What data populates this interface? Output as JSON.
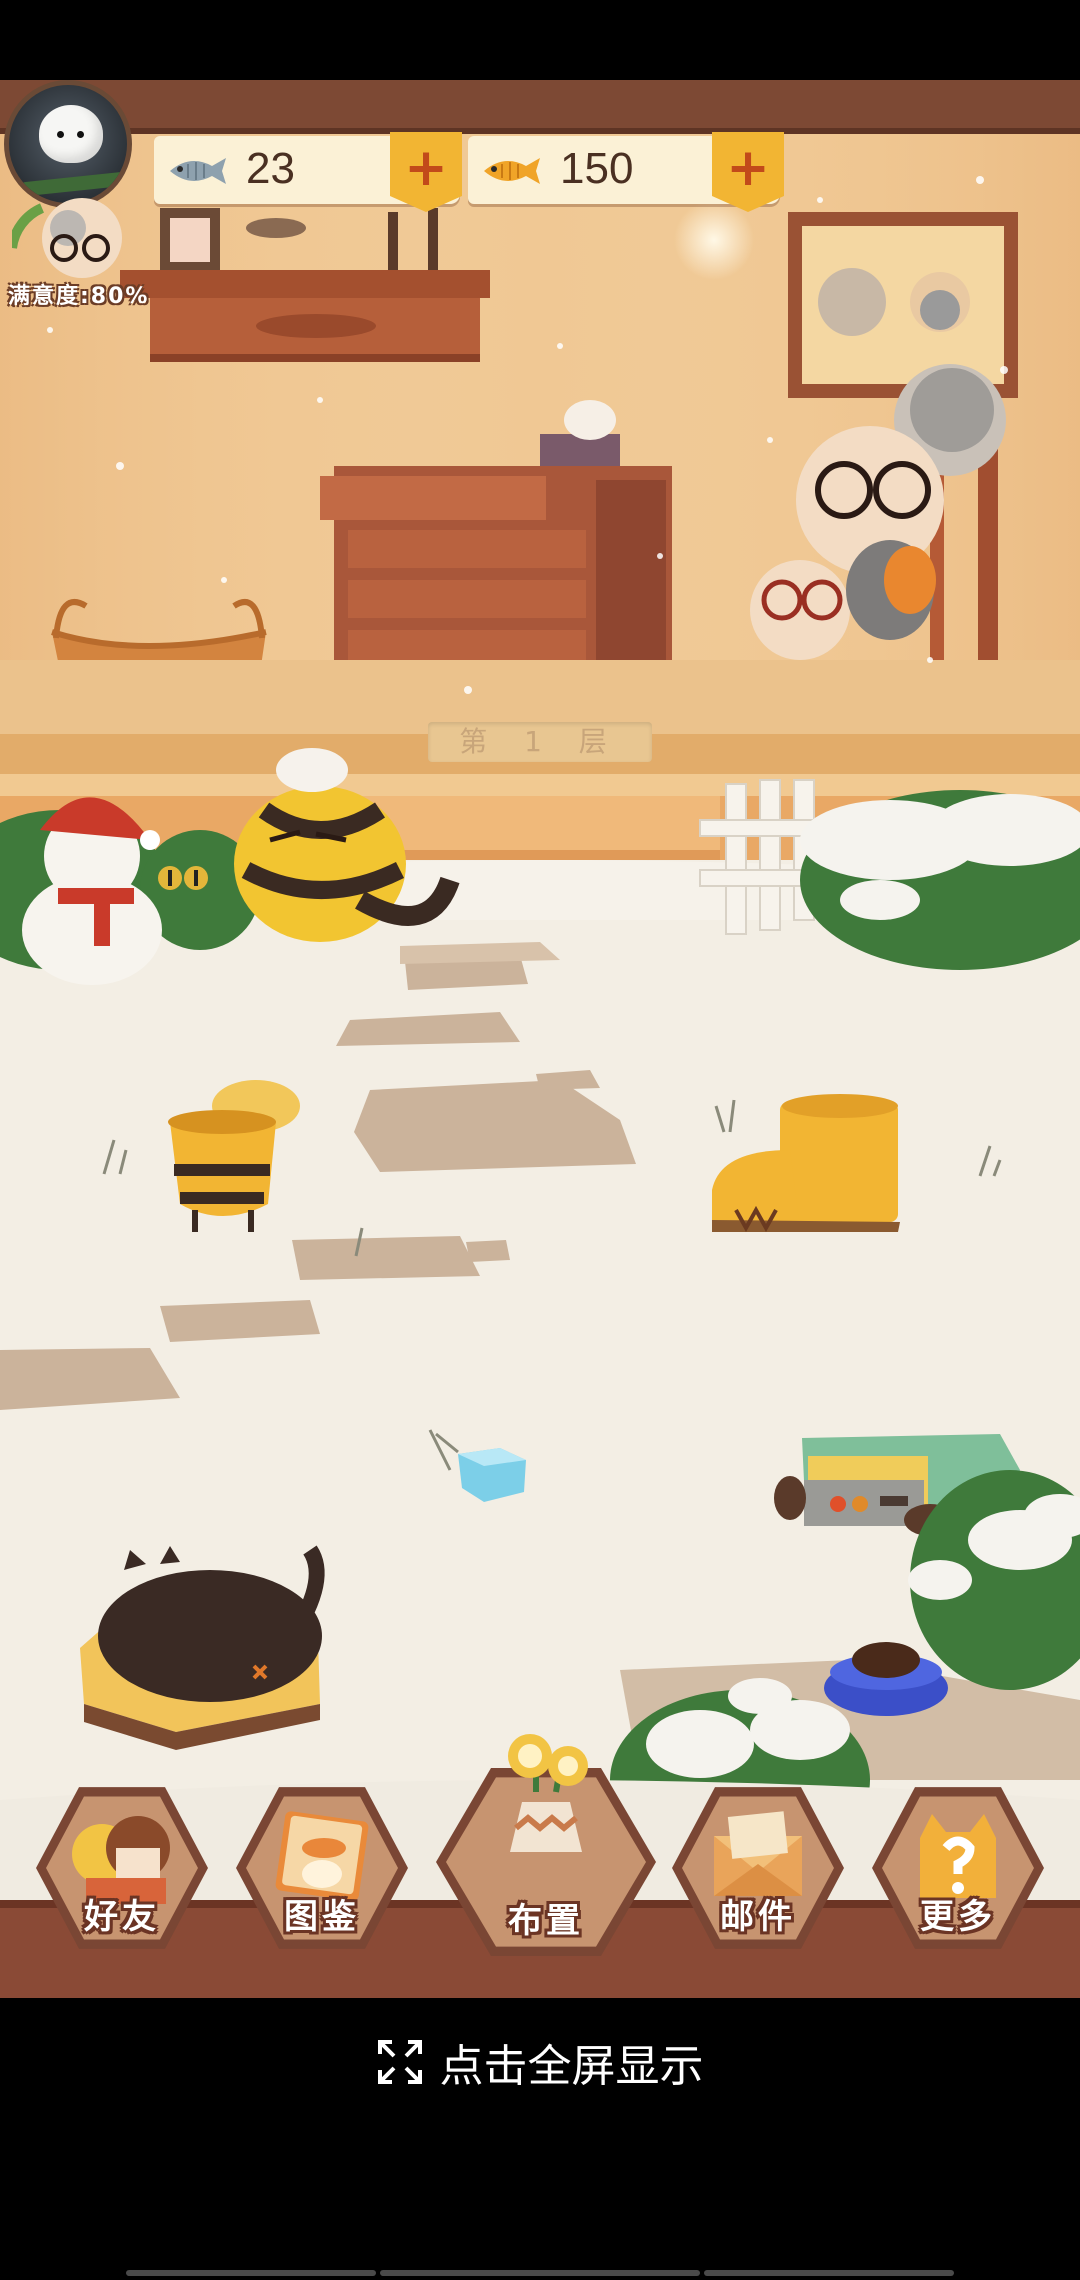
{
  "hud": {
    "dried_fish_count": "23",
    "gold_fish_count": "150",
    "add_symbol": "+",
    "satisfaction_label": "满意度:80%"
  },
  "scene": {
    "floor_label": "第 1 层"
  },
  "menu": {
    "friends": "好友",
    "guide": "图鉴",
    "layout": "布置",
    "mail": "邮件",
    "more": "更多"
  },
  "footer": {
    "fullscreen_label": "点击全屏显示"
  },
  "icons": {
    "avatar": "bird-avatar-icon",
    "dried_fish": "dried-fish-icon",
    "gold_fish": "gold-fish-icon",
    "fullscreen": "expand-icon"
  },
  "colors": {
    "room_wall": "#f0c894",
    "floor_beam": "#e9b77a",
    "snow": "#f4efe6",
    "hud_plus": "#f2b533",
    "menu_frame": "#7a4634"
  }
}
